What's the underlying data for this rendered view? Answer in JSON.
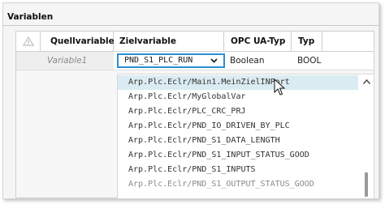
{
  "panel": {
    "title": "Variablen"
  },
  "table": {
    "headers": {
      "source": "Quellvariable",
      "target": "Zielvariable",
      "opcua": "OPC UA-Typ",
      "type": "Typ"
    },
    "row": {
      "source": "Variable1",
      "target": "PND_S1_PLC_RUN",
      "opcua": "Boolean",
      "type": "BOOL"
    }
  },
  "dropdown": {
    "options": [
      "Arp.Plc.Eclr/Main1.MeinZielINPort",
      "Arp.Plc.Eclr/MyGlobalVar",
      "Arp.Plc.Eclr/PLC_CRC_PRJ",
      "Arp.Plc.Eclr/PND_IO_DRIVEN_BY_PLC",
      "Arp.Plc.Eclr/PND_S1_DATA_LENGTH",
      "Arp.Plc.Eclr/PND_S1_INPUT_STATUS_GOOD",
      "Arp.Plc.Eclr/PND_S1_INPUTS",
      "Arp.Plc.Eclr/PND_S1_OUTPUT_STATUS_GOOD"
    ],
    "highlighted_index": 0
  },
  "colors": {
    "accent": "#2a8fd0",
    "highlight": "#daecf2"
  },
  "icons": {
    "header_corner": "triangle-warning-icon",
    "select_chevron": "chevron-down-icon",
    "scroll_up": "chevron-up-icon",
    "pointer": "mouse-pointer-icon"
  }
}
